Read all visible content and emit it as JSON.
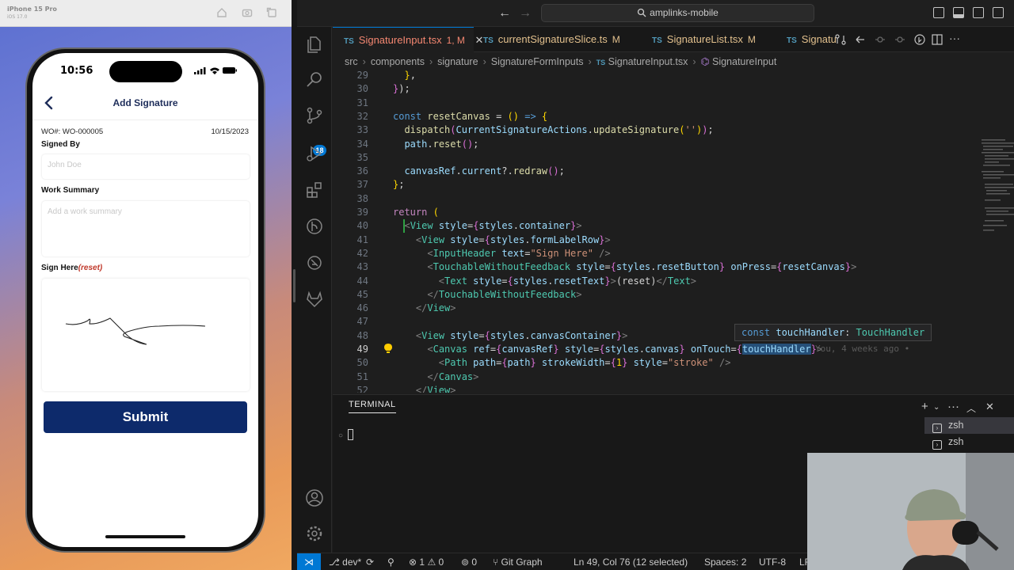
{
  "simulator": {
    "device_name": "iPhone 15 Pro",
    "os_version": "iOS 17.0"
  },
  "phone": {
    "time": "10:56",
    "screen_title": "Add Signature",
    "wo_number": "WO#: WO-000005",
    "date": "10/15/2023",
    "signed_by_label": "Signed By",
    "signed_by_placeholder": "John Doe",
    "work_summary_label": "Work Summary",
    "work_summary_placeholder": "Add a work summary",
    "sign_here_label": "Sign Here",
    "reset_label": "(reset)",
    "submit_label": "Submit"
  },
  "vscode": {
    "search_text": "amplinks-mobile",
    "tabs": [
      {
        "icon": "TS",
        "label": "SignatureInput.tsx",
        "status": "1, M",
        "active": true
      },
      {
        "icon": "TS",
        "label": "currentSignatureSlice.ts",
        "status": "M",
        "active": false
      },
      {
        "icon": "TS",
        "label": "SignatureList.tsx",
        "status": "M",
        "active": false
      },
      {
        "icon": "TS",
        "label": "Signatu",
        "status": "",
        "active": false
      }
    ],
    "breadcrumb": [
      "src",
      "components",
      "signature",
      "SignatureFormInputs",
      "SignatureInput.tsx",
      "SignatureInput"
    ],
    "line_numbers": [
      "29",
      "30",
      "31",
      "32",
      "33",
      "34",
      "35",
      "36",
      "37",
      "38",
      "39",
      "40",
      "41",
      "42",
      "43",
      "44",
      "45",
      "46",
      "47",
      "48",
      "49",
      "50",
      "51",
      "52"
    ],
    "current_line": "49",
    "hover_text": "const touchHandler: TouchHandler",
    "blame_text": "You, 4 weeks ago •",
    "activity_badge": "18",
    "panel": {
      "title": "TERMINAL",
      "terminals": [
        "zsh",
        "zsh"
      ]
    },
    "statusbar": {
      "branch": "dev*",
      "errors": "1",
      "warnings": "0",
      "ports": "0",
      "git_graph": "Git Graph",
      "position": "Ln 49, Col 76 (12 selected)",
      "spaces": "Spaces: 2",
      "encoding": "UTF-8",
      "eol": "LF"
    }
  },
  "colors": {
    "accent": "#0078d4",
    "submit_bg": "#0d2a6b",
    "title_text": "#1e2d5a",
    "reset_red": "#c0392b"
  }
}
